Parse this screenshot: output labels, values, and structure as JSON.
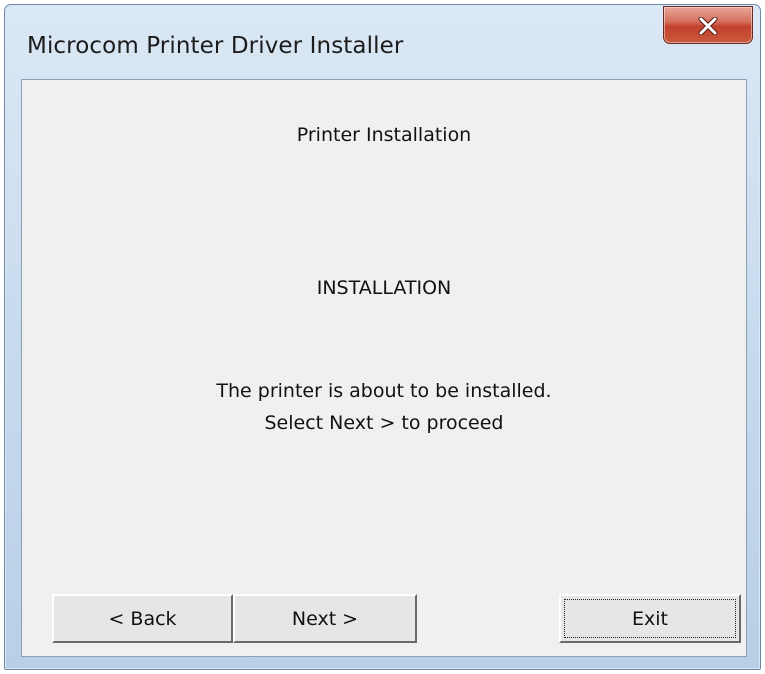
{
  "window": {
    "title": "Microcom Printer Driver Installer"
  },
  "content": {
    "heading": "Printer Installation",
    "section": "INSTALLATION",
    "message_line1": "The printer is about to be installed.",
    "message_line2": "Select Next > to proceed"
  },
  "buttons": {
    "back_label": "< Back",
    "next_label": "Next >",
    "exit_label": "Exit"
  },
  "icons": {
    "close": "close-icon"
  },
  "colors": {
    "close_button": "#c4412d",
    "client_background": "#f0f0f0"
  }
}
